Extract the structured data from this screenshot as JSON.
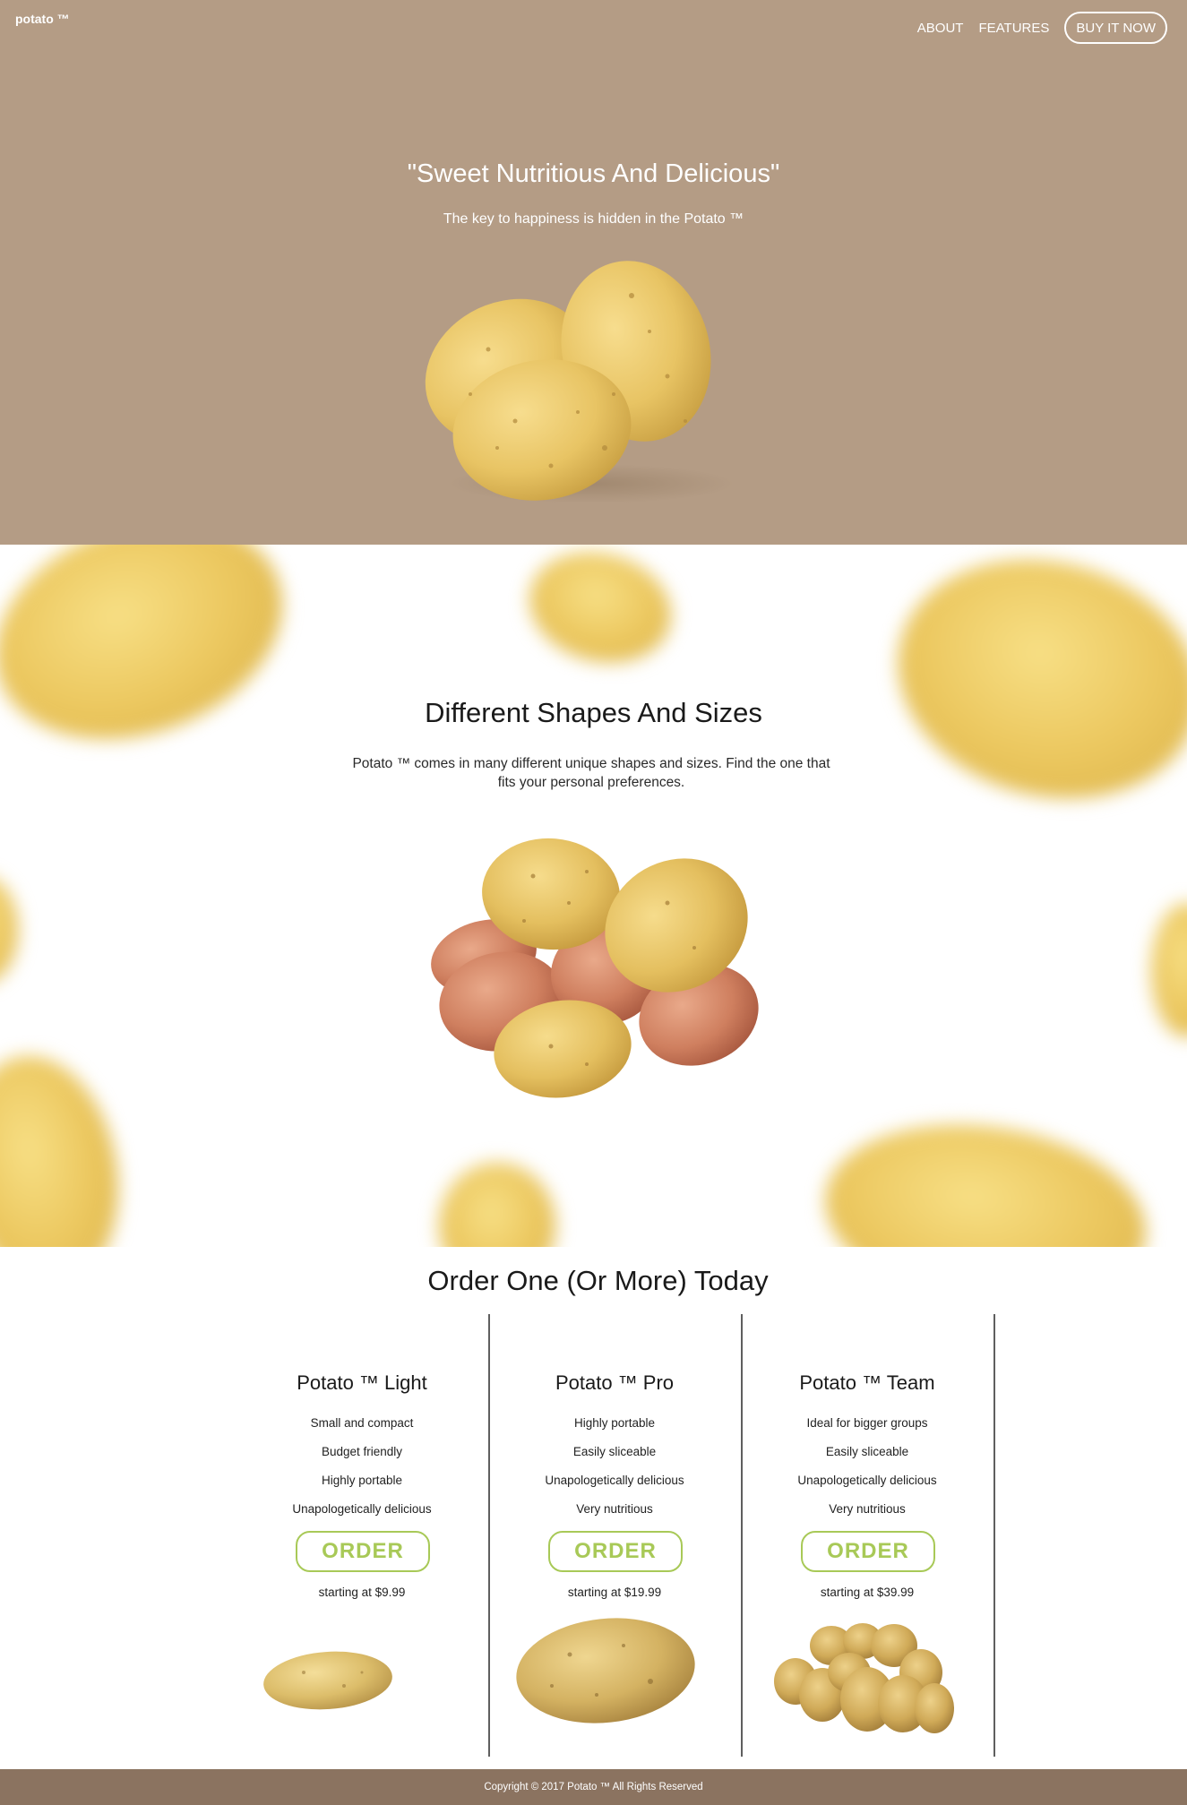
{
  "nav": {
    "logo": "potato ™",
    "links": [
      "ABOUT",
      "FEATURES"
    ],
    "cta": "BUY IT NOW"
  },
  "hero": {
    "title": "\"Sweet Nutritious And Delicious\"",
    "subtitle": "The key to happiness is hidden in the Potato ™",
    "image_icon": "potato-trio-icon"
  },
  "shapes": {
    "title": "Different Shapes And Sizes",
    "description": "Potato ™ comes in many different unique shapes and sizes. Find the one that fits your personal preferences.",
    "image_icon": "mixed-potatoes-icon"
  },
  "order": {
    "title": "Order One (Or More) Today",
    "plans": [
      {
        "name": "Potato ™ Light",
        "features": [
          "Small and compact",
          "Budget friendly",
          "Highly portable",
          "Unapologetically delicious"
        ],
        "button": "ORDER",
        "price": "starting at $9.99",
        "image_icon": "small-potato-icon"
      },
      {
        "name": "Potato ™ Pro",
        "features": [
          "Highly portable",
          "Easily sliceable",
          "Unapologetically delicious",
          "Very nutritious"
        ],
        "button": "ORDER",
        "price": "starting at $19.99",
        "image_icon": "large-potato-icon"
      },
      {
        "name": "Potato ™ Team",
        "features": [
          "Ideal for bigger groups",
          "Easily sliceable",
          "Unapologetically delicious",
          "Very nutritious"
        ],
        "button": "ORDER",
        "price": "starting at $39.99",
        "image_icon": "potato-pile-icon"
      }
    ]
  },
  "footer": {
    "copyright": "Copyright © 2017 Potato ™ All Rights Reserved"
  },
  "colors": {
    "hero_bg": "#b49c85",
    "footer_bg": "#8b7360",
    "accent_green": "#a8c957",
    "potato_yellow": "#e8c464"
  }
}
